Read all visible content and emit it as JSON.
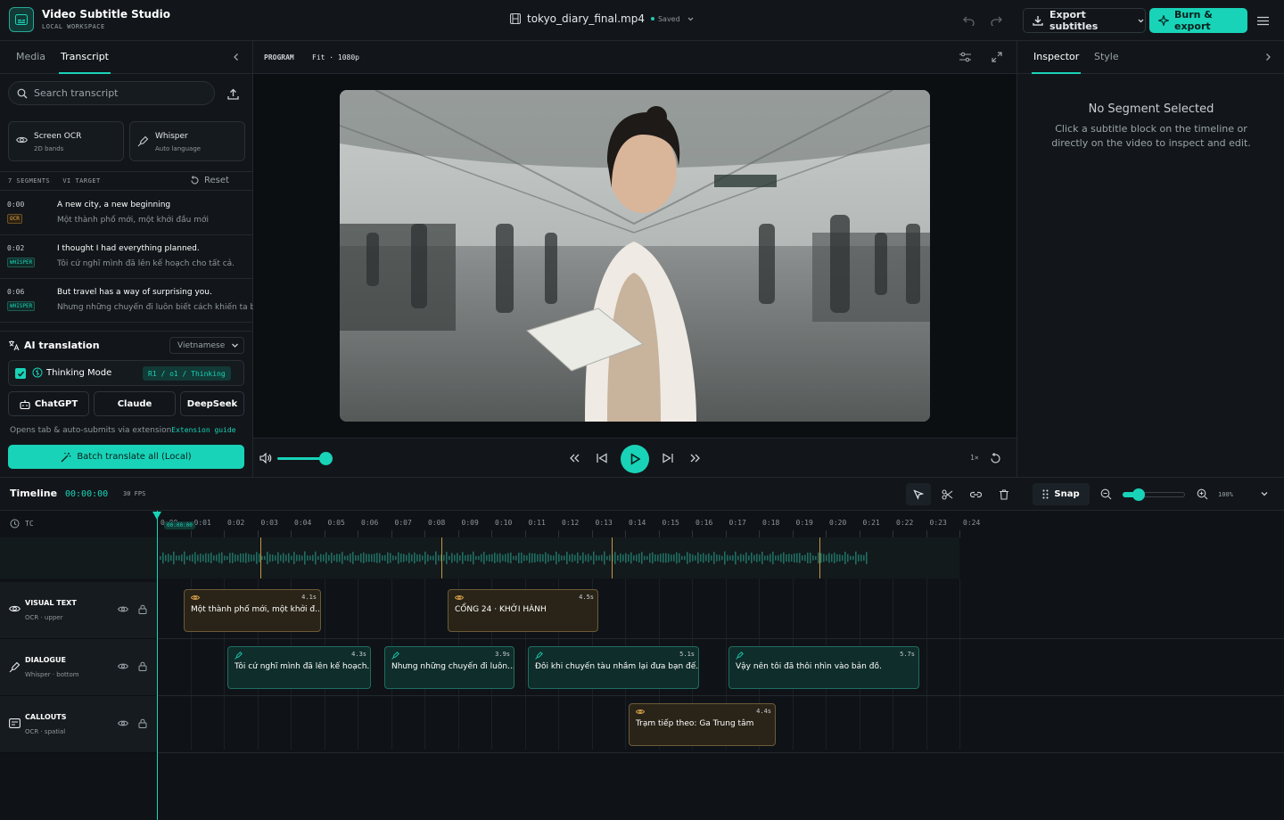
{
  "app": {
    "name": "Video Subtitle Studio",
    "workspace": "LOCAL WORKSPACE"
  },
  "file": {
    "name": "tokyo_diary_final.mp4",
    "status": "Saved"
  },
  "topbar": {
    "export_label": "Export subtitles",
    "burn_label": "Burn & export"
  },
  "left": {
    "tabs": [
      "Media",
      "Transcript"
    ],
    "search_placeholder": "Search transcript",
    "sources": [
      {
        "title": "Screen OCR",
        "sub": "2D bands"
      },
      {
        "title": "Whisper",
        "sub": "Auto language"
      }
    ],
    "seg_count": "7 SEGMENTS",
    "seg_target": "VI TARGET",
    "reset": "Reset",
    "segments": [
      {
        "tc": "0:00",
        "badge": "OCR",
        "src": "A new city, a new beginning",
        "tr": "Một thành phố mới, một khởi đầu mới"
      },
      {
        "tc": "0:02",
        "badge": "WHISPER",
        "src": "I thought I had everything planned.",
        "tr": "Tôi cứ nghĩ mình đã lên kế hoạch cho tất cả."
      },
      {
        "tc": "0:06",
        "badge": "WHISPER",
        "src": "But travel has a way of surprising you.",
        "tr": "Nhưng những chuyến đi luôn biết cách khiến ta bất ngờ."
      }
    ],
    "ai": {
      "title": "AI translation",
      "language": "Vietnamese",
      "thinking_label": "Thinking Mode",
      "thinking_tag": "R1 / o1 / Thinking",
      "providers": [
        "ChatGPT",
        "Claude",
        "DeepSeek"
      ],
      "hint": "Opens tab & auto-submits via extension",
      "hint_link": "Extension guide",
      "batch_label": "Batch translate all (Local)"
    }
  },
  "program": {
    "label": "PROGRAM",
    "fit": "Fit · 1080p",
    "speed": "1×",
    "volume_fraction": 0.85
  },
  "inspector": {
    "tabs": [
      "Inspector",
      "Style"
    ],
    "empty_title": "No Segment Selected",
    "empty_body": "Click a subtitle block on the timeline or directly on the video to inspect and edit."
  },
  "timeline": {
    "title": "Timeline",
    "timecode": "00:00:00",
    "fps": "30 FPS",
    "snap": "Snap",
    "zoom": "100%",
    "tc_label": "TC",
    "playhead_tag": "00:00:00",
    "ticks": [
      "0:00",
      "0:01",
      "0:02",
      "0:03",
      "0:04",
      "0:05",
      "0:06",
      "0:07",
      "0:08",
      "0:09",
      "0:10",
      "0:11",
      "0:12",
      "0:13",
      "0:14",
      "0:15",
      "0:16",
      "0:17",
      "0:18",
      "0:19",
      "0:20",
      "0:21",
      "0:22",
      "0:23",
      "0:24"
    ],
    "tracks": [
      {
        "name": "VISUAL TEXT",
        "sub": "OCR · upper"
      },
      {
        "name": "DIALOGUE",
        "sub": "Whisper · bottom"
      },
      {
        "name": "CALLOUTS",
        "sub": "OCR · spatial"
      }
    ],
    "clips": {
      "visual": [
        {
          "text": "Một thành phố mới, một khởi đ...",
          "dur": "4.1s"
        },
        {
          "text": "CỔNG 24 · KHỞI HÀNH",
          "dur": "4.5s"
        }
      ],
      "dialogue": [
        {
          "text": "Tôi cứ nghĩ mình đã lên kế hoạch...",
          "dur": "4.3s"
        },
        {
          "text": "Nhưng những chuyến đi luôn...",
          "dur": "3.9s"
        },
        {
          "text": "Đôi khi chuyến tàu nhầm lại đưa bạn đế...",
          "dur": "5.1s"
        },
        {
          "text": "Vậy nên tôi đã thôi nhìn vào bản đồ.",
          "dur": "5.7s"
        }
      ],
      "callouts": [
        {
          "text": "Trạm tiếp theo: Ga Trung tâm",
          "dur": "4.4s"
        }
      ]
    }
  },
  "colors": {
    "accent": "#19d3b8",
    "ocr": "#e0a64a",
    "bg": "#0f1317"
  }
}
